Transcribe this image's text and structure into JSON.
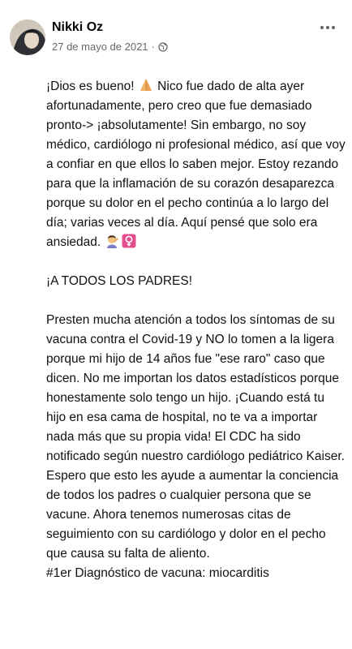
{
  "post": {
    "author": "Nikki Oz",
    "date": "27 de mayo de 2021",
    "separator": "·",
    "privacy_icon": "globe-icon",
    "more_icon": "more-options-icon",
    "paragraph1_a": "¡Dios es bueno! ",
    "emoji_pray": "folded-hands-emoji",
    "paragraph1_b": " Nico fue dado de alta ayer afortunadamente, pero creo que fue demasiado pronto-> ¡absolutamente! Sin embargo, no soy médico, cardiólogo ni profesional médico, así que voy a confiar en que ellos lo saben mejor. Estoy rezando para que la inflamación de su corazón desaparezca porque su dolor en el pecho continúa a lo largo del día; varias veces al día. Aquí pensé que solo era ansiedad. ",
    "emoji_facepalm": "facepalm-emoji",
    "emoji_female": "female-sign-emoji",
    "paragraph2": "¡A TODOS LOS PADRES!",
    "paragraph3": "Presten mucha atención a todos los síntomas de su vacuna contra el Covid-19 y NO lo tomen a la ligera porque mi hijo de 14 años fue \"ese raro\" caso que dicen. No me importan los datos estadísticos porque honestamente solo tengo un hijo. ¡Cuando está tu hijo en esa cama de hospital, no te va a importar nada más que su propia vida! El CDC ha sido notificado según nuestro cardiólogo pediátrico Kaiser. Espero que esto les ayude a aumentar la conciencia de todos los padres o cualquier persona que se vacune. Ahora tenemos numerosas citas de seguimiento con su cardiólogo y dolor en el pecho que causa su falta de aliento.",
    "paragraph4": "#1er Diagnóstico de vacuna: miocarditis"
  }
}
